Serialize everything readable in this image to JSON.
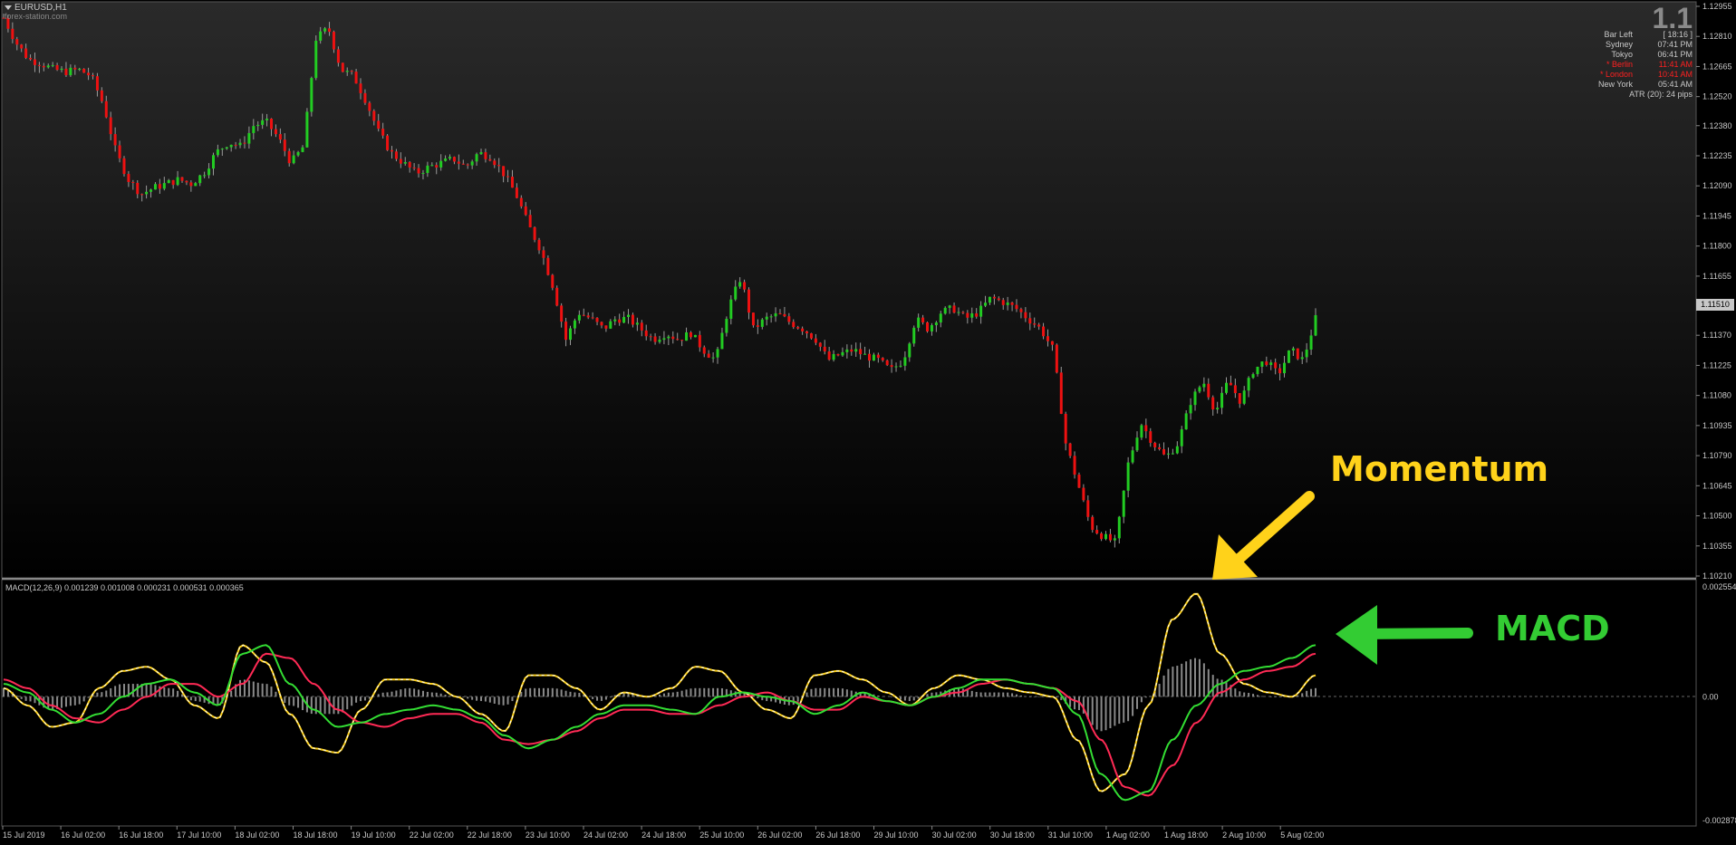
{
  "header": {
    "symbol": "EURUSD,H1",
    "source": "forex-station.com",
    "big_value": "1.1"
  },
  "info_panel": {
    "rows": [
      {
        "label": "Bar Left",
        "value": "[ 18:16 ]",
        "color": "#c8c8c8"
      },
      {
        "label": "Sydney",
        "value": "07:41 PM",
        "color": "#c8c8c8"
      },
      {
        "label": "Tokyo",
        "value": "06:41 PM",
        "color": "#c8c8c8"
      },
      {
        "label": "* Berlin",
        "value": "11:41 AM",
        "color": "#ff2020"
      },
      {
        "label": "* London",
        "value": "10:41 AM",
        "color": "#ff2020"
      },
      {
        "label": "New York",
        "value": "05:41 AM",
        "color": "#c8c8c8"
      }
    ],
    "atr": "ATR (20): 24 pips"
  },
  "current_price": "1.11510",
  "price_axis": [
    "1.12955",
    "1.12810",
    "1.12665",
    "1.12520",
    "1.12380",
    "1.12235",
    "1.12090",
    "1.11945",
    "1.11800",
    "1.11655",
    "1.11370",
    "1.11225",
    "1.11080",
    "1.10935",
    "1.10790",
    "1.10645",
    "1.10500",
    "1.10355",
    "1.10210"
  ],
  "macd": {
    "label": "MACD(12,26,9) 0.001239 0.001008 0.000231 0.000531 0.000365",
    "axis": [
      "0.002554",
      "0.00",
      "-0.002878"
    ],
    "colors": {
      "fast": "#33dd33",
      "signal": "#ff2a55",
      "momentum": "#ffd21a",
      "hist": "#8a8a8a"
    }
  },
  "time_axis": [
    "15 Jul 2019",
    "16 Jul 02:00",
    "16 Jul 18:00",
    "17 Jul 10:00",
    "18 Jul 02:00",
    "18 Jul 18:00",
    "19 Jul 10:00",
    "22 Jul 02:00",
    "22 Jul 18:00",
    "23 Jul 10:00",
    "24 Jul 02:00",
    "24 Jul 18:00",
    "25 Jul 10:00",
    "26 Jul 02:00",
    "26 Jul 18:00",
    "29 Jul 10:00",
    "30 Jul 02:00",
    "30 Jul 18:00",
    "31 Jul 10:00",
    "1 Aug 02:00",
    "1 Aug 18:00",
    "2 Aug 10:00",
    "5 Aug 02:00"
  ],
  "annotations": {
    "momentum": "Momentum",
    "macd": "MACD"
  },
  "colors": {
    "bull": "#22cc22",
    "bear": "#ee1111",
    "wick": "#9a9a9a",
    "bg_top": "#2a2a2a",
    "bg_bottom": "#000000"
  },
  "price_path": [
    1.129,
    1.1278,
    1.127,
    1.1268,
    1.1265,
    1.1264,
    1.1265,
    1.1262,
    1.1248,
    1.1225,
    1.1212,
    1.1205,
    1.1208,
    1.121,
    1.1212,
    1.121,
    1.1215,
    1.1225,
    1.123,
    1.1228,
    1.1238,
    1.124,
    1.1232,
    1.122,
    1.1228,
    1.128,
    1.1285,
    1.1265,
    1.1262,
    1.125,
    1.1235,
    1.1225,
    1.122,
    1.1215,
    1.1218,
    1.122,
    1.1222,
    1.1218,
    1.1225,
    1.1223,
    1.1215,
    1.1205,
    1.119,
    1.1178,
    1.116,
    1.1135,
    1.1148,
    1.1145,
    1.114,
    1.1145,
    1.1145,
    1.114,
    1.1135,
    1.1138,
    1.1135,
    1.1138,
    1.113,
    1.1125,
    1.115,
    1.1165,
    1.114,
    1.1145,
    1.1147,
    1.1143,
    1.114,
    1.1135,
    1.1125,
    1.1128,
    1.113,
    1.1127,
    1.1125,
    1.112,
    1.1125,
    1.1145,
    1.114,
    1.1148,
    1.115,
    1.1145,
    1.1148,
    1.1155,
    1.1153,
    1.115,
    1.1145,
    1.114,
    1.113,
    1.1085,
    1.1065,
    1.1045,
    1.104,
    1.1037,
    1.1075,
    1.1095,
    1.1085,
    1.1078,
    1.1085,
    1.1105,
    1.1115,
    1.11,
    1.1115,
    1.1105,
    1.112,
    1.1125,
    1.1118,
    1.113,
    1.1125,
    1.1145
  ],
  "macd_path": {
    "fast": [
      0.0003,
      0.0001,
      -0.0003,
      -0.0006,
      -0.0004,
      0.0,
      0.0003,
      0.0004,
      0.0001,
      -0.0002,
      0.001,
      0.0012,
      0.0003,
      -0.0003,
      -0.0007,
      -0.0006,
      -0.0004,
      -0.0003,
      -0.0002,
      -0.0003,
      -0.0005,
      -0.0009,
      -0.0012,
      -0.001,
      -0.0007,
      -0.0004,
      -0.0002,
      -0.0002,
      -0.0003,
      -0.0004,
      0.0,
      0.0001,
      0.0,
      -0.0001,
      -0.0004,
      -0.0002,
      0.0001,
      -0.0001,
      -0.0002,
      0.0,
      0.0002,
      0.0004,
      0.0004,
      0.0003,
      0.0002,
      -0.0004,
      -0.0018,
      -0.0024,
      -0.0022,
      -0.001,
      -0.0002,
      0.0003,
      0.0006,
      0.0007,
      0.0009,
      0.0012
    ],
    "signal": [
      0.0004,
      0.0002,
      -0.0002,
      -0.0005,
      -0.0006,
      -0.0003,
      0.0,
      0.0003,
      0.0003,
      0.0,
      0.0003,
      0.001,
      0.0009,
      0.0003,
      -0.0003,
      -0.0006,
      -0.0007,
      -0.0005,
      -0.0004,
      -0.0004,
      -0.0006,
      -0.001,
      -0.0011,
      -0.001,
      -0.0008,
      -0.0005,
      -0.0003,
      -0.0003,
      -0.0004,
      -0.0004,
      -0.0002,
      0.0,
      0.0001,
      -0.0001,
      -0.0003,
      -0.0003,
      0.0,
      -0.0001,
      -0.0002,
      0.0,
      0.0001,
      0.0003,
      0.0004,
      0.0003,
      0.0002,
      -0.0001,
      -0.001,
      -0.0021,
      -0.0023,
      -0.0016,
      -0.0006,
      0.0001,
      0.0004,
      0.0006,
      0.0007,
      0.001
    ],
    "momentum": [
      0.0002,
      -0.0002,
      -0.0007,
      -0.0006,
      0.0002,
      0.0006,
      0.0007,
      0.0004,
      -0.0002,
      -0.0005,
      0.0012,
      0.0008,
      -0.0004,
      -0.0012,
      -0.0013,
      -0.0003,
      0.0004,
      0.0004,
      0.0003,
      0.0,
      -0.0004,
      -0.0008,
      0.0005,
      0.0005,
      0.0002,
      -0.0003,
      0.0001,
      0.0,
      0.0002,
      0.0007,
      0.0006,
      0.0001,
      -0.0003,
      -0.0005,
      0.0005,
      0.0006,
      0.0004,
      0.0001,
      -0.0002,
      0.0002,
      0.0005,
      0.0004,
      0.0002,
      0.0001,
      0.0,
      -0.001,
      -0.0022,
      -0.0018,
      -0.0002,
      0.0018,
      0.0024,
      0.001,
      0.0003,
      0.0001,
      0.0,
      0.0005
    ],
    "hist": [
      0.0002,
      -0.0001,
      -0.0003,
      -0.0002,
      0.0001,
      0.0003,
      0.0003,
      0.0002,
      -0.0001,
      -0.0002,
      0.0004,
      0.0003,
      -0.0002,
      -0.0004,
      -0.0004,
      -0.0001,
      0.0001,
      0.0002,
      0.0001,
      0.0,
      -0.0001,
      -0.0002,
      0.0002,
      0.0002,
      0.0001,
      -0.0001,
      0.0001,
      0.0,
      0.0001,
      0.0002,
      0.0002,
      0.0001,
      -0.0001,
      -0.0002,
      0.0002,
      0.0002,
      0.0001,
      0.0,
      -0.0001,
      0.0001,
      0.0002,
      0.0001,
      0.0001,
      0.0,
      0.0,
      -0.0003,
      -0.0008,
      -0.0006,
      0.0,
      0.0007,
      0.0009,
      0.0004,
      0.0001,
      0.0,
      0.0,
      0.0002
    ]
  }
}
